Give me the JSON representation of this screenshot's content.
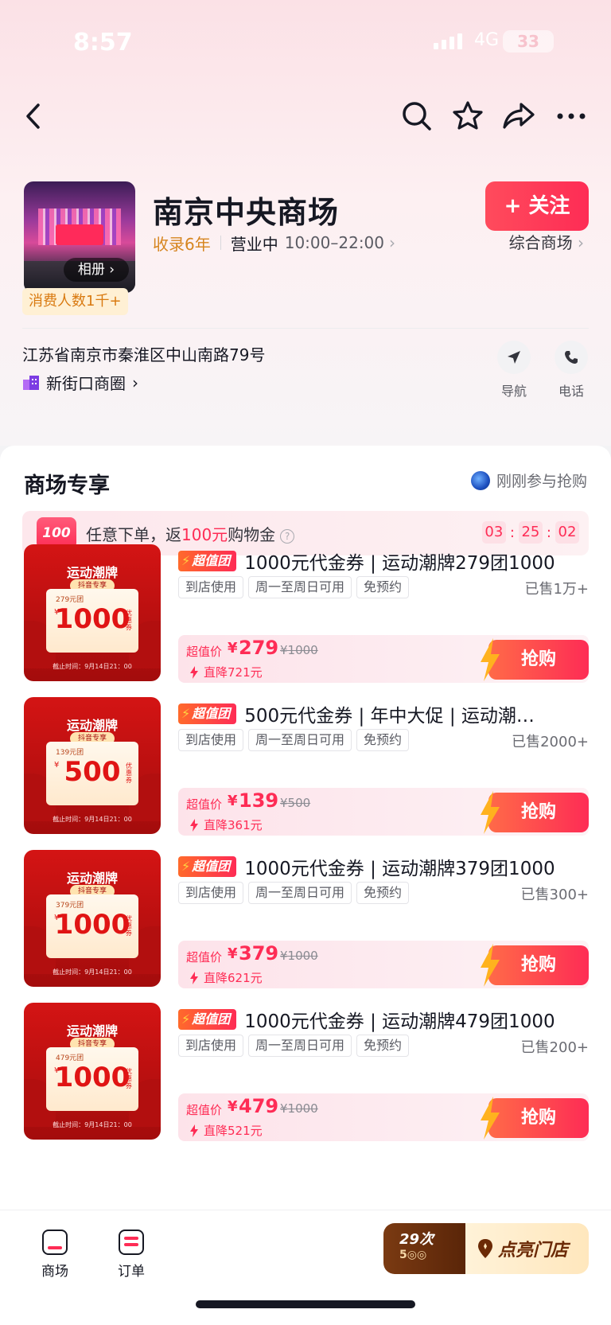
{
  "status": {
    "time": "8:57",
    "network": "4G",
    "battery": "33"
  },
  "store": {
    "name": "南京中央商场",
    "album_label": "相册",
    "follow_label": "+ 关注",
    "years": "收录6年",
    "status": "营业中",
    "hours": "10:00–22:00",
    "category": "综合商场",
    "badge": "消费人数1千+",
    "address": "江苏省南京市秦淮区中山南路79号",
    "district": "新街口商圈",
    "nav_label": "导航",
    "phone_label": "电话"
  },
  "section": {
    "title": "商场专享",
    "right_label": "刚刚参与抢购",
    "promo_icon": "100",
    "promo_prefix": "任意下单，返",
    "promo_amount": "100元",
    "promo_suffix": "购物金",
    "timer": [
      "03",
      "25",
      "02"
    ]
  },
  "deals": [
    {
      "badge": "超值团",
      "name": "1000元代金券 | 运动潮牌279团1000",
      "chips": [
        "到店使用",
        "周一至周日可用",
        "免预约"
      ],
      "sold": "已售1万+",
      "price_label": "超值价",
      "price": "279",
      "orig": "¥1000",
      "drop": "直降721元",
      "buy": "抢购",
      "thumb": {
        "title": "运动潮牌",
        "tag": "抖音专享",
        "small": "279元团",
        "value": "1000",
        "unit": "优惠券",
        "foot": "截止时间：9月14日21：00"
      }
    },
    {
      "badge": "超值团",
      "name": "500元代金券 | 年中大促 | 运动潮…",
      "chips": [
        "到店使用",
        "周一至周日可用",
        "免预约"
      ],
      "sold": "已售2000+",
      "price_label": "超值价",
      "price": "139",
      "orig": "¥500",
      "drop": "直降361元",
      "buy": "抢购",
      "thumb": {
        "title": "运动潮牌",
        "tag": "抖音专享",
        "small": "139元团",
        "value": "500",
        "unit": "优惠券",
        "foot": "截止时间：9月14日21：00"
      }
    },
    {
      "badge": "超值团",
      "name": "1000元代金券 | 运动潮牌379团1000",
      "chips": [
        "到店使用",
        "周一至周日可用",
        "免预约"
      ],
      "sold": "已售300+",
      "price_label": "超值价",
      "price": "379",
      "orig": "¥1000",
      "drop": "直降621元",
      "buy": "抢购",
      "thumb": {
        "title": "运动潮牌",
        "tag": "抖音专享",
        "small": "379元团",
        "value": "1000",
        "unit": "优惠券",
        "foot": "截止时间：9月14日21：00"
      }
    },
    {
      "badge": "超值团",
      "name": "1000元代金券 | 运动潮牌479团1000",
      "chips": [
        "到店使用",
        "周一至周日可用",
        "免预约"
      ],
      "sold": "已售200+",
      "price_label": "超值价",
      "price": "479",
      "orig": "¥1000",
      "drop": "直降521元",
      "buy": "抢购",
      "thumb": {
        "title": "运动潮牌",
        "tag": "抖音专享",
        "small": "479元团",
        "value": "1000",
        "unit": "优惠券",
        "foot": "截止时间：9月14日21：00"
      }
    }
  ],
  "tabbar": {
    "tab1": "商场",
    "tab2": "订单",
    "light_count": "29次",
    "light_sub": "5◎◎",
    "light_label": "点亮门店"
  },
  "colors": {
    "accent": "#fe2c55",
    "gold": "#d6851f"
  }
}
